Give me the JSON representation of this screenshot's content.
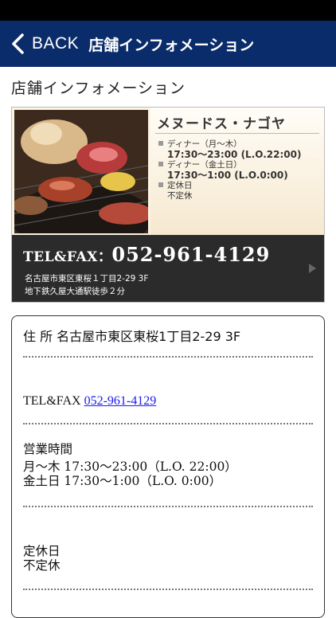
{
  "nav": {
    "back_label": "BACK",
    "title": "店舗インフォメーション"
  },
  "page": {
    "heading": "店舗インフォメーション"
  },
  "banner": {
    "shop_name": "メヌードス・ナゴヤ",
    "hours": [
      {
        "label": "ディナー（月〜木）",
        "value": "17:30〜23:00 (L.O.22:00)"
      },
      {
        "label": "ディナー（金土日）",
        "value": "17:30〜1:00 (L.O.0:00)"
      }
    ],
    "holiday_label": "定休日",
    "holiday_value": "不定休",
    "tel_label": "TEL&FAX：",
    "tel_number": "052-961-4129",
    "address": "名古屋市東区東桜１丁目2-29 3F",
    "access": "地下鉄久屋大通駅徒歩２分"
  },
  "info": {
    "address_line": "住 所 名古屋市東区東桜1丁目2-29 3F",
    "tel_label": "TEL&FAX ",
    "tel_link": "052-961-4129",
    "hours_heading": "営業時間",
    "hours_weekday": "月〜木 17:30〜23:00（L.O. 22:00）",
    "hours_weekend": "金土日 17:30〜1:00（L.O. 0:00）",
    "holiday_heading": "定休日",
    "holiday_value": "不定休"
  },
  "colors": {
    "navbar": "#0b2c6a",
    "link": "#1a1aee",
    "banner_dark": "#2b2b2b"
  }
}
